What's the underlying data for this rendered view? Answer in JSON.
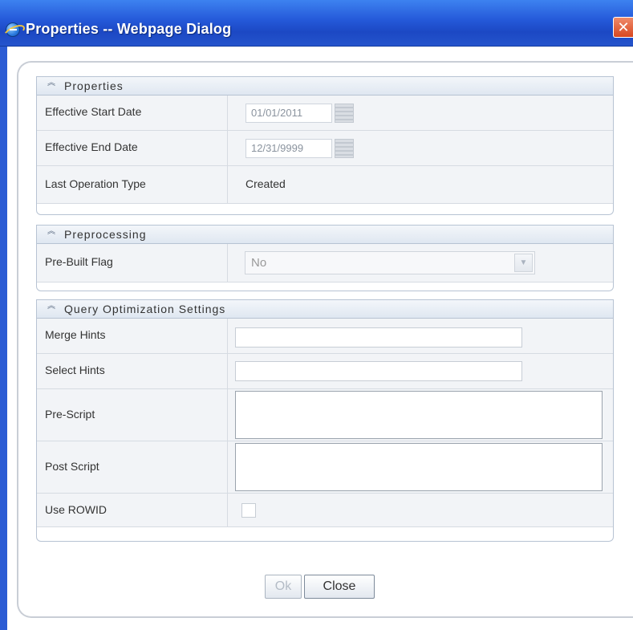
{
  "window": {
    "title": "Properties -- Webpage Dialog",
    "close_glyph": "✕"
  },
  "sections": {
    "properties": {
      "title": "Properties",
      "rows": {
        "effective_start_date": {
          "label": "Effective Start Date",
          "value": "01/01/2011"
        },
        "effective_end_date": {
          "label": "Effective End Date",
          "value": "12/31/9999"
        },
        "last_operation_type": {
          "label": "Last Operation Type",
          "value": "Created"
        }
      }
    },
    "preprocessing": {
      "title": "Preprocessing",
      "rows": {
        "pre_built_flag": {
          "label": "Pre-Built Flag",
          "value": "No"
        }
      }
    },
    "query_optimization": {
      "title": "Query Optimization Settings",
      "rows": {
        "merge_hints": {
          "label": "Merge Hints",
          "value": ""
        },
        "select_hints": {
          "label": "Select Hints",
          "value": ""
        },
        "pre_script": {
          "label": "Pre-Script",
          "value": ""
        },
        "post_script": {
          "label": "Post Script",
          "value": ""
        },
        "use_rowid": {
          "label": "Use ROWID",
          "checked": false
        }
      }
    }
  },
  "buttons": {
    "ok": "Ok",
    "close": "Close"
  },
  "icons": {
    "collapse": "double-chevron-up",
    "calendar": "calendar",
    "dropdown": "chevron-down"
  },
  "colors": {
    "titlebar": "#2458d8",
    "section_header": "#e6ecf3",
    "row_background": "#f2f4f7"
  }
}
